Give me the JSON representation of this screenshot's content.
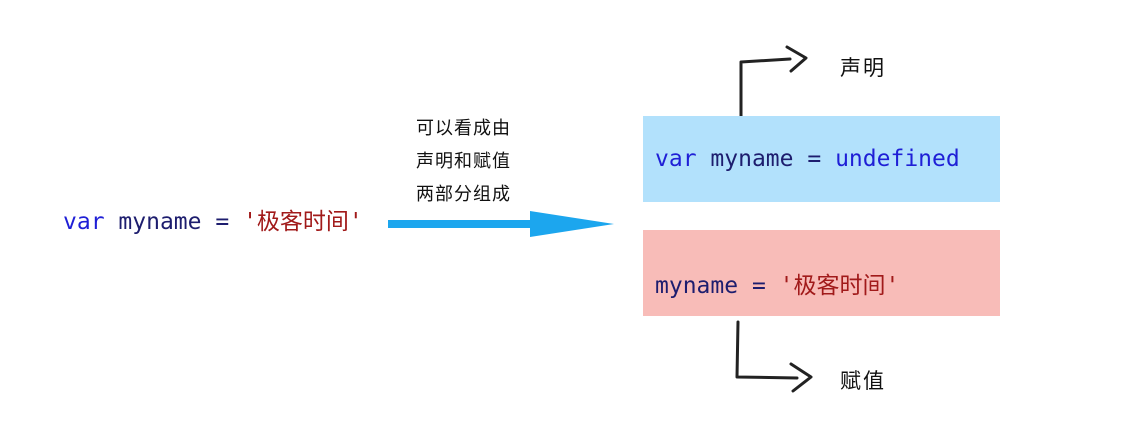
{
  "source": {
    "keyword": "var",
    "name": "myname",
    "operator": "=",
    "value": "'极客时间'"
  },
  "note": {
    "lines": [
      "可以看成由",
      "声明和赋值",
      "两部分组成"
    ]
  },
  "declaration": {
    "keyword": "var",
    "name": "myname",
    "operator": "=",
    "value": "undefined",
    "label": "声明"
  },
  "assignment": {
    "name": "myname",
    "operator": "=",
    "value": "'极客时间'",
    "label": "赋值"
  },
  "colors": {
    "declaration_box": "#b2e1fc",
    "assignment_box": "#f8bcb8",
    "main_arrow": "#1ca6ee",
    "keyword": "#1f1fd6",
    "identifier": "#1d1d6e",
    "string": "#a11a1a"
  }
}
